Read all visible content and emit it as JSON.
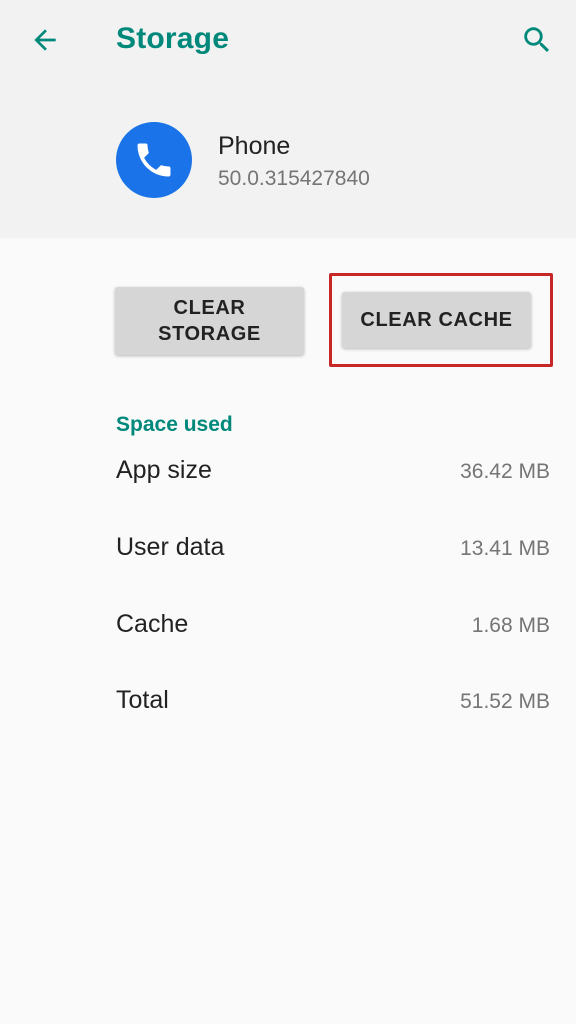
{
  "app_bar": {
    "title": "Storage",
    "back_icon": "arrow-back-icon",
    "search_icon": "search-icon"
  },
  "app": {
    "name": "Phone",
    "version": "50.0.315427840",
    "icon": "phone-handset-icon"
  },
  "actions": {
    "clear_storage_label": "CLEAR STORAGE",
    "clear_cache_label": "CLEAR CACHE"
  },
  "space_used": {
    "header": "Space used",
    "rows": [
      {
        "label": "App size",
        "value": "36.42 MB"
      },
      {
        "label": "User data",
        "value": "13.41 MB"
      },
      {
        "label": "Cache",
        "value": "1.68 MB"
      },
      {
        "label": "Total",
        "value": "51.52 MB"
      }
    ]
  },
  "colors": {
    "accent": "#00897b",
    "app_icon_bg": "#1a73e8",
    "highlight": "#c62828",
    "header_bg": "#f2f2f2",
    "page_bg": "#fafafa",
    "button_bg": "#d6d6d6"
  }
}
